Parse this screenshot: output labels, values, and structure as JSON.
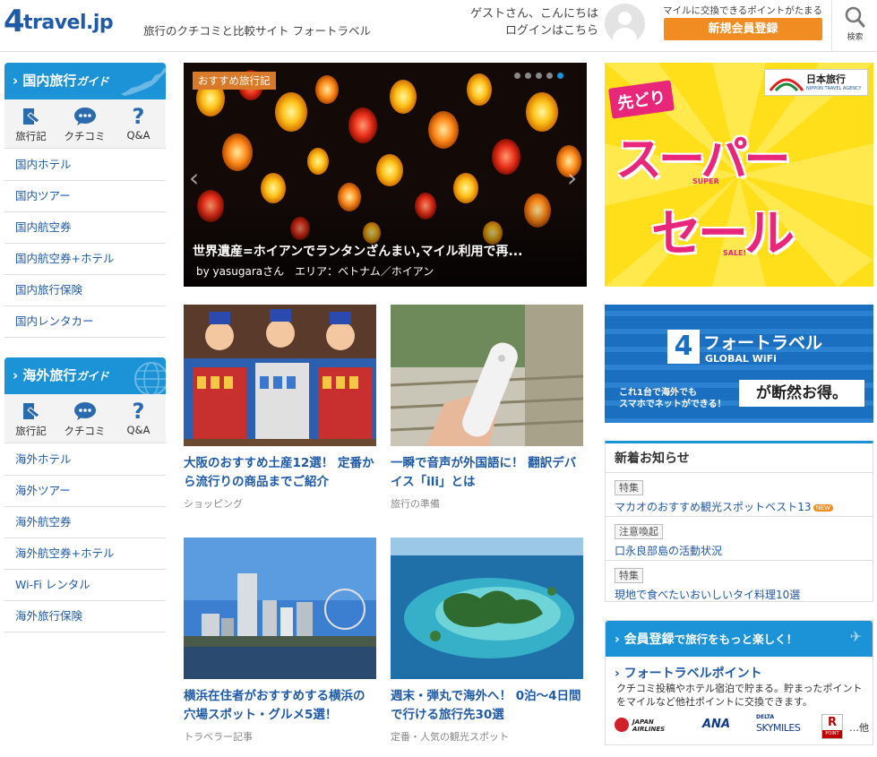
{
  "header": {
    "logo_num": "4",
    "logo_text": "travel.jp",
    "tagline": "旅行のクチコミと比較サイト フォートラベル",
    "greeting": "ゲストさん、こんにちは",
    "login": "ログインはこちら",
    "promo_note": "マイルに交換できるポイントがたまる",
    "signup_label": "新規会員登録",
    "search_label": "検索"
  },
  "sidebar": {
    "domestic": {
      "title": "国内旅行",
      "subtitle": "ガイド",
      "icons": [
        "旅行記",
        "クチコミ",
        "Q&A"
      ],
      "items": [
        "国内ホテル",
        "国内ツアー",
        "国内航空券",
        "国内航空券+ホテル",
        "国内旅行保険",
        "国内レンタカー"
      ]
    },
    "overseas": {
      "title": "海外旅行",
      "subtitle": "ガイド",
      "icons": [
        "旅行記",
        "クチコミ",
        "Q&A"
      ],
      "items": [
        "海外ホテル",
        "海外ツアー",
        "海外航空券",
        "海外航空券+ホテル",
        "Wi-Fi レンタル",
        "海外旅行保険"
      ]
    }
  },
  "hero": {
    "tag": "おすすめ旅行記",
    "title": "世界遺産=ホイアンでランタンざんまい,マイル利用で再...",
    "byline": "by yasugaraさん　エリア：ベトナム／ホイアン",
    "slide_count": 5,
    "active_slide": 5
  },
  "cards": [
    {
      "title": "大阪のおすすめ土産12選！ 定番から流行りの商品までご紹介",
      "category": "ショッピング"
    },
    {
      "title": "一瞬で音声が外国語に！ 翻訳デバイス「ili」とは",
      "category": "旅行の準備"
    },
    {
      "title": "横浜在住者がおすすめする横浜の穴場スポット・グルメ5選！",
      "category": "トラベラー記事"
    },
    {
      "title": "週末・弾丸で海外へ！ 0泊～4日間で行ける旅行先30選",
      "category": "定番・人気の観光スポット"
    }
  ],
  "ads": {
    "sale": {
      "badge": "先どり",
      "line1": "スーパー",
      "line2": "セール",
      "sub1": "SUPER",
      "sub2": "SALE!",
      "brand": "日本旅行",
      "brand_en": "NIPPON TRAVEL AGENCY"
    },
    "wifi": {
      "brand": "フォートラベル",
      "sub": "GLOBAL WiFi",
      "copy1": "これ1台で海外でも",
      "copy2": "スマホでネットができる！",
      "tagline": "が断然お得。"
    }
  },
  "news": {
    "title": "新着お知らせ",
    "items": [
      {
        "tag": "特集",
        "text": "マカオのおすすめ観光スポットベスト13",
        "new": "NEW"
      },
      {
        "tag": "注意喚起",
        "text": "口永良部島の活動状況",
        "new": ""
      },
      {
        "tag": "特集",
        "text": "現地で食べたいおいしいタイ料理10選",
        "new": ""
      }
    ]
  },
  "member": {
    "head_main": "会員登録",
    "head_sub": "で旅行をもっと楽しく！",
    "points_title": "フォートラベルポイント",
    "points_desc": "クチコミ投稿やホテル宿泊で貯まる。貯まったポイントをマイルなど他社ポイントに交換できます。",
    "partners": [
      "JAPAN AIRLINES",
      "ANA",
      "SKYMILES",
      "POINT",
      "…他"
    ],
    "partner_sub": [
      "DELTA"
    ]
  },
  "colors": {
    "accent": "#1c93d6",
    "link": "#1f5aa6",
    "signup": "#f08c22",
    "sale_bg": "#ffde1a",
    "sale_text": "#e8267a"
  }
}
